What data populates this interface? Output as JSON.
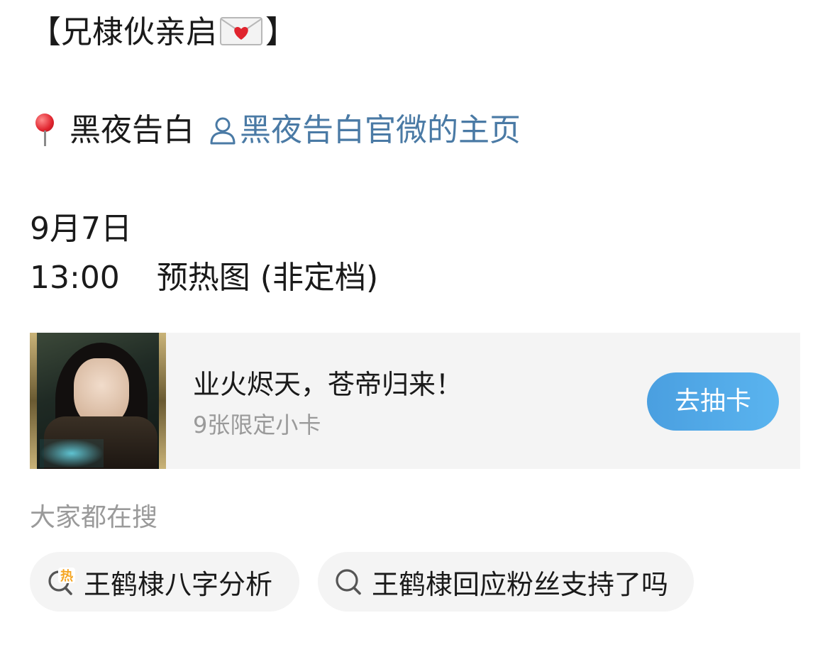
{
  "post": {
    "title_open": "【兄棣伙亲启",
    "title_close": "】",
    "location_name": "黑夜告白",
    "location_link": "黑夜告白官微的主页",
    "date": "9月7日",
    "time": "13:00",
    "event": "预热图 (非定档)"
  },
  "card": {
    "title": "业火烬天，苍帝归来！",
    "subtitle": "9张限定小卡",
    "button_label": "去抽卡"
  },
  "search": {
    "header": "大家都在搜",
    "items": [
      {
        "label": "王鹤棣八字分析",
        "icon": "hot-search-icon"
      },
      {
        "label": "王鹤棣回应粉丝支持了吗",
        "icon": "search-icon"
      }
    ]
  },
  "colors": {
    "link": "#4a7aa5",
    "button": "#4a9fe0",
    "muted": "#9a9a9a",
    "hot": "#f5a623"
  }
}
